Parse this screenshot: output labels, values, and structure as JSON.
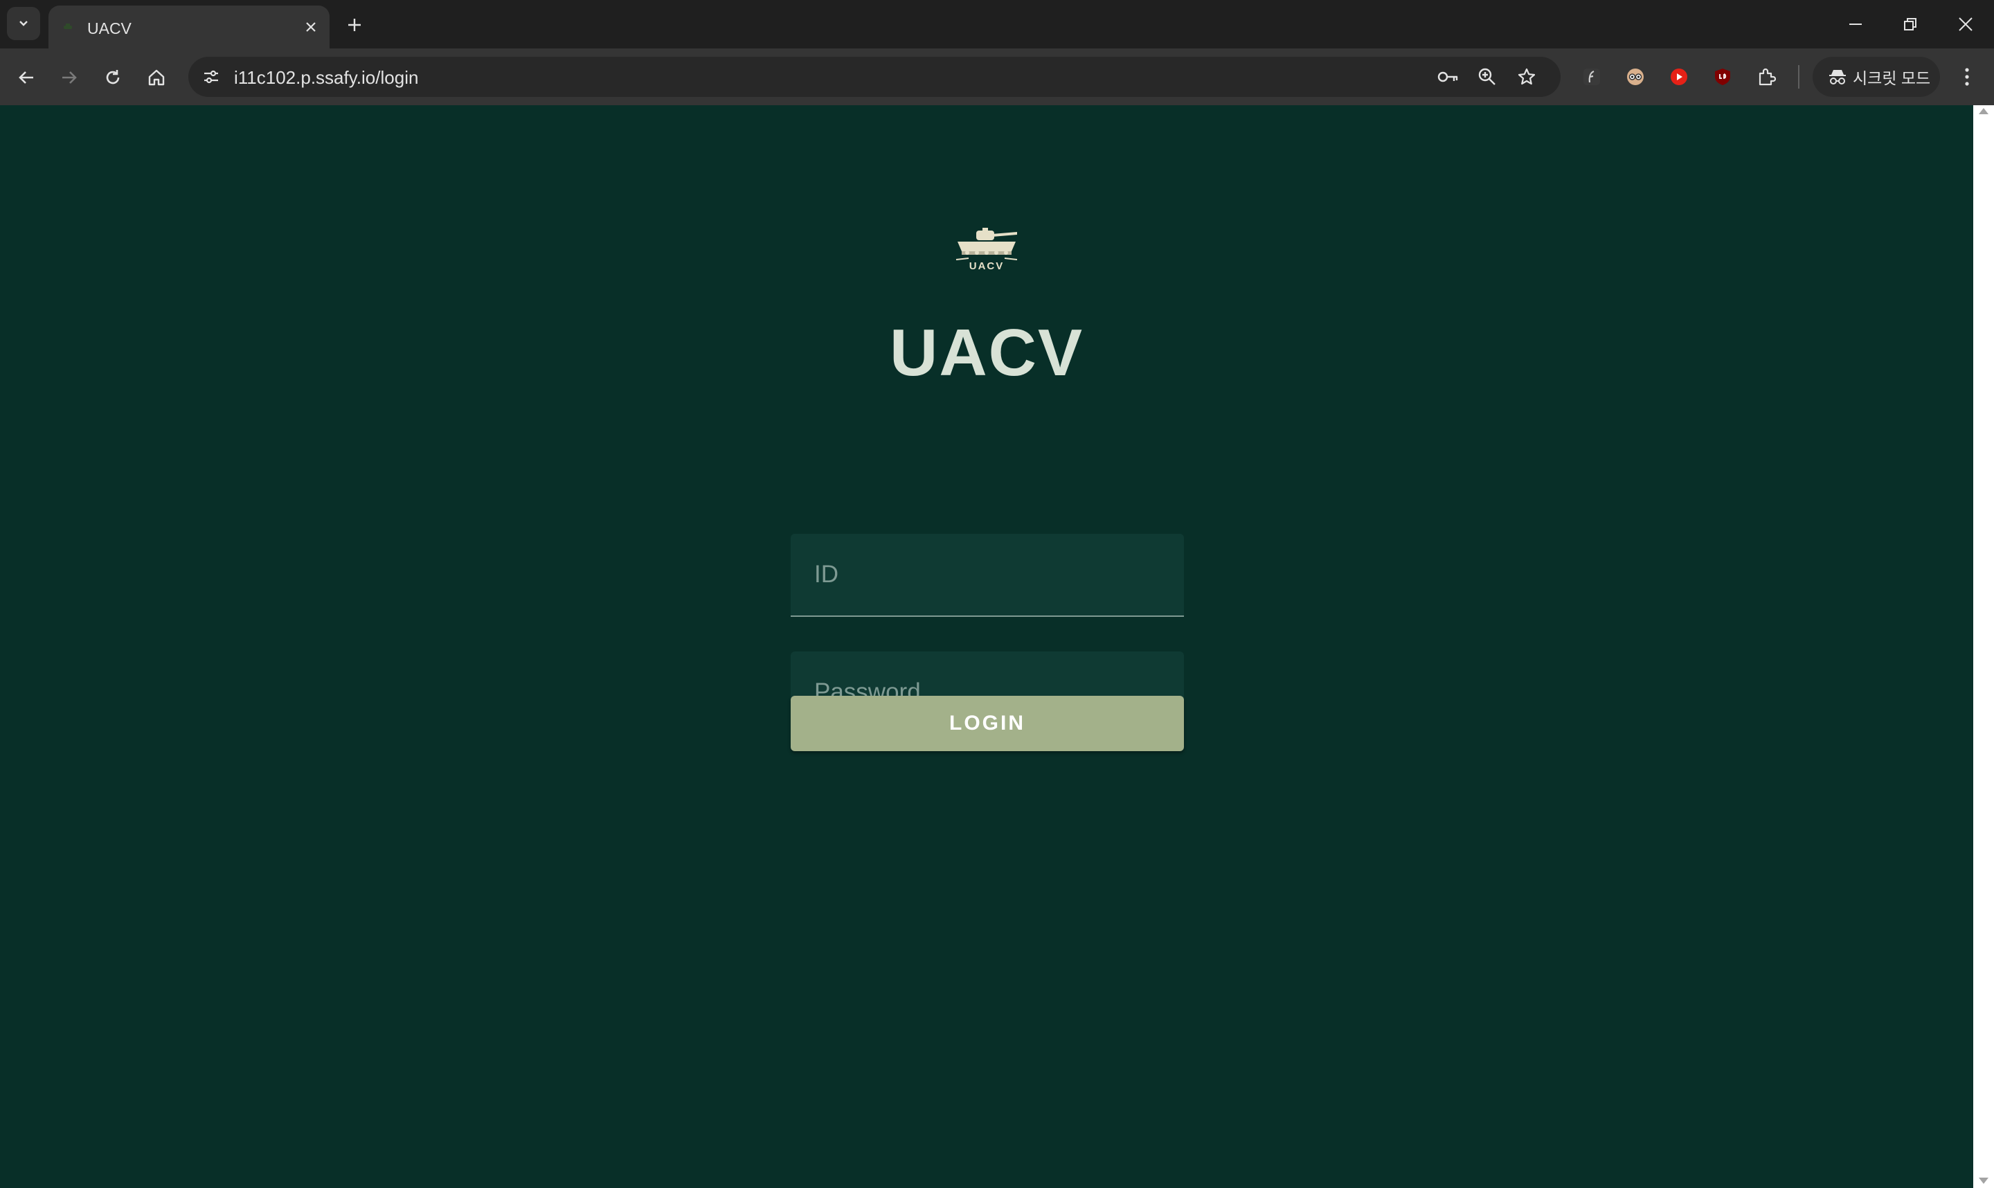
{
  "browser": {
    "tab": {
      "title": "UACV"
    },
    "url": "i11c102.p.ssafy.io/login",
    "incognito_label": "시크릿 모드"
  },
  "page": {
    "logo_text": "UACV",
    "title": "UACV",
    "id_placeholder": "ID",
    "password_placeholder": "Password",
    "login_label": "LOGIN"
  },
  "colors": {
    "background": "#082f28",
    "field_background": "#0f3a33",
    "button": "#a3b18a",
    "title": "#d8e2d6"
  }
}
